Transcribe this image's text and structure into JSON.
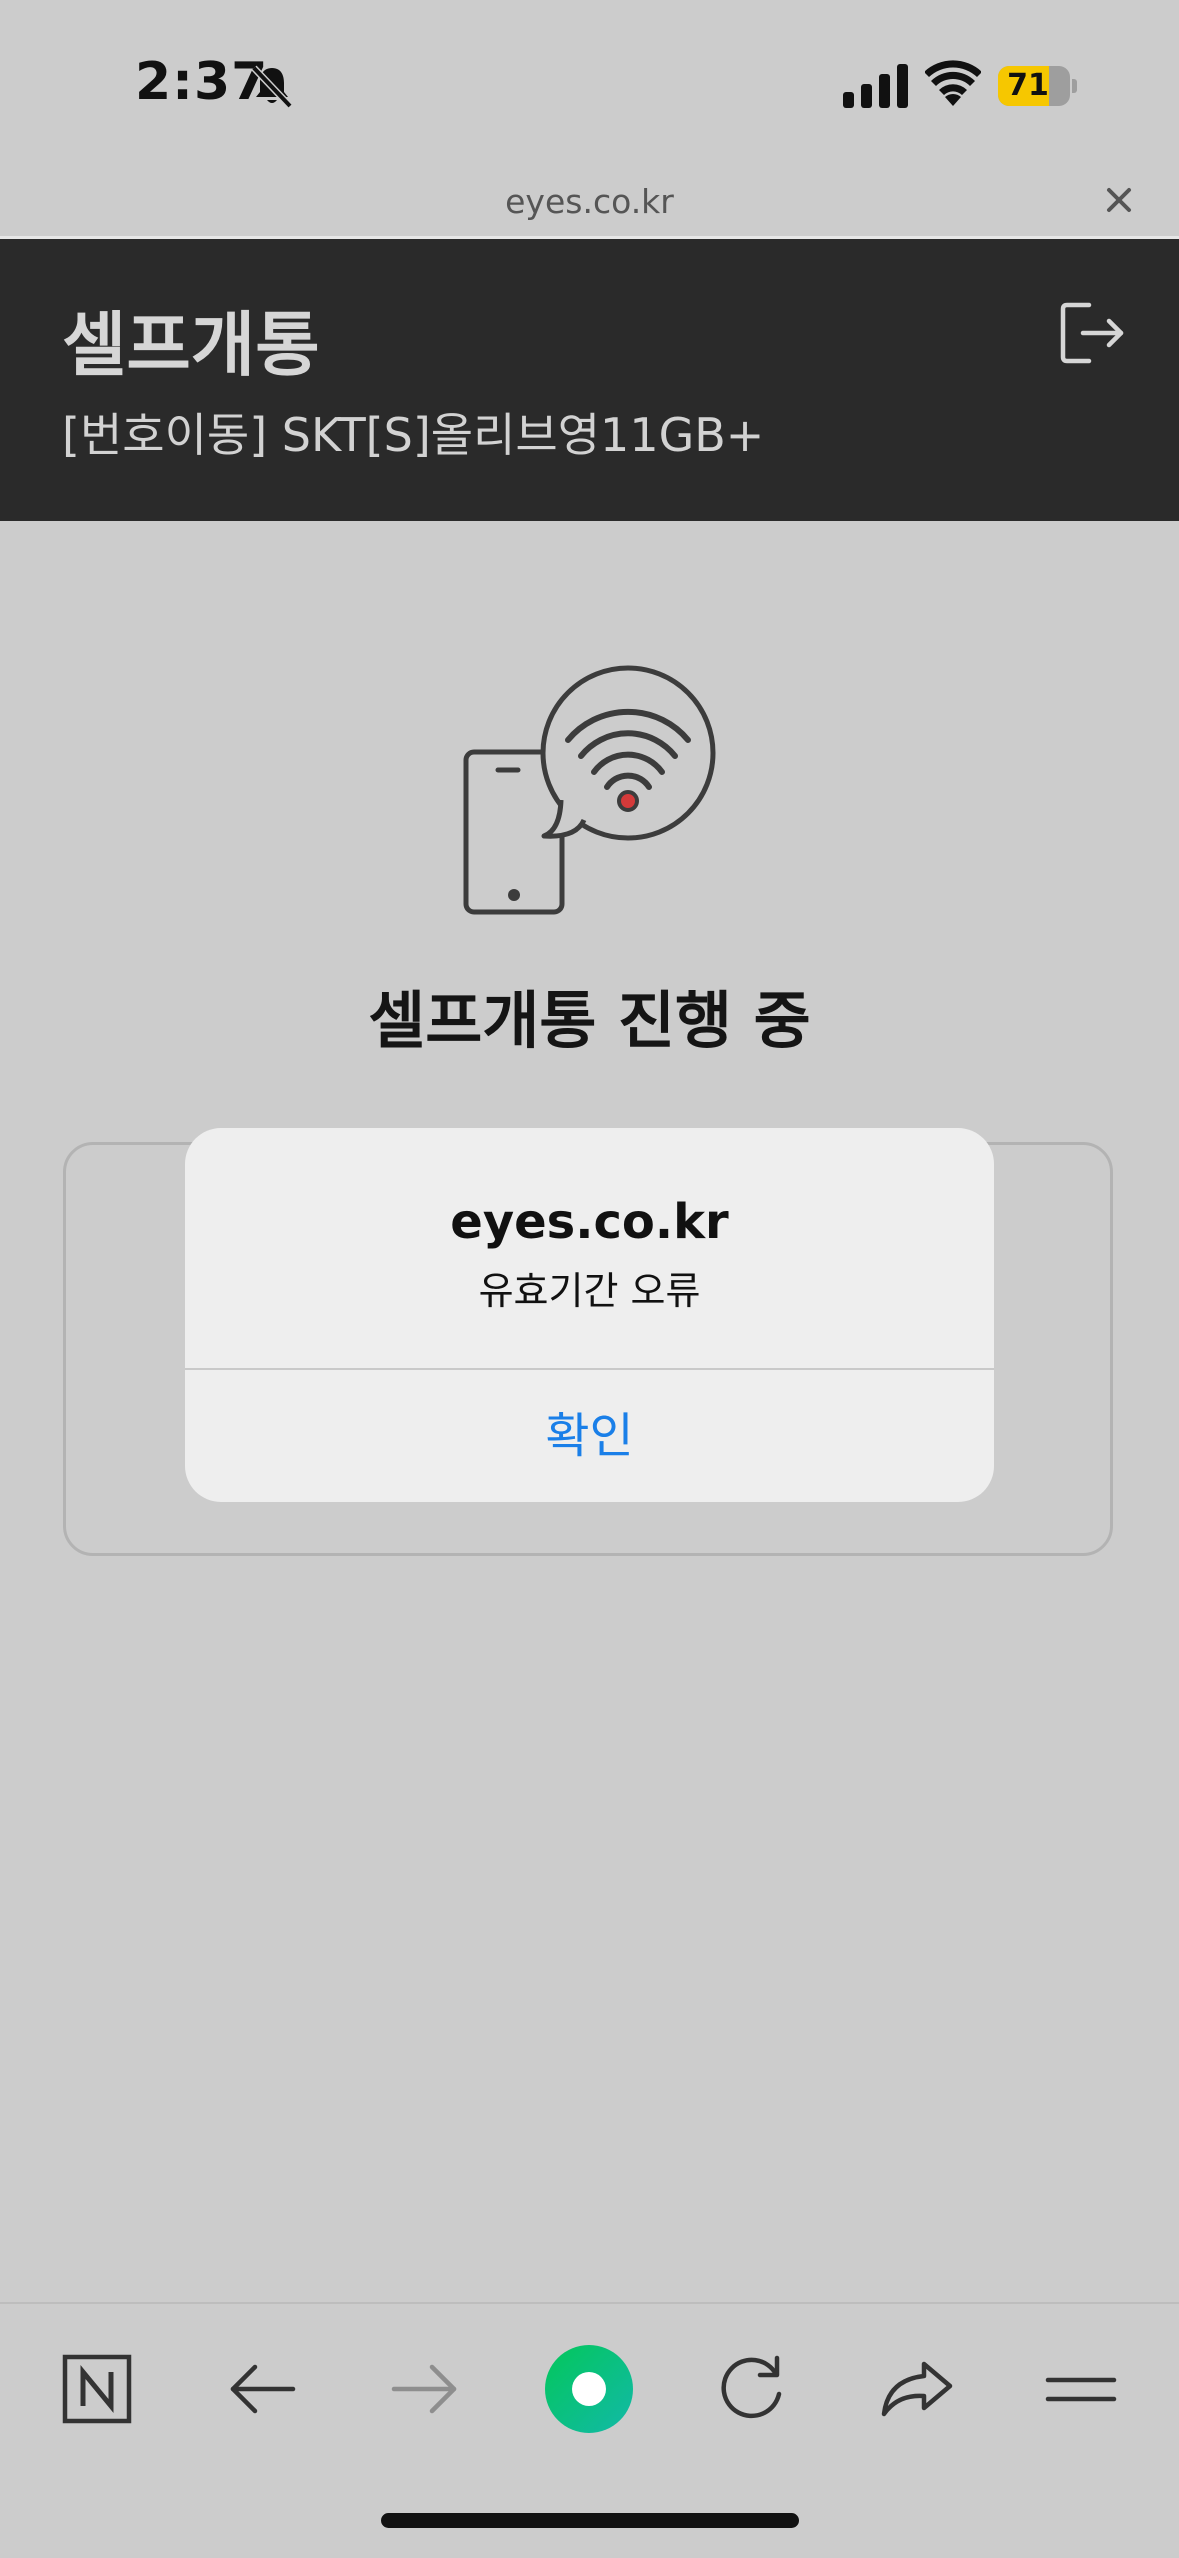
{
  "status_bar": {
    "time": "2:37",
    "battery_percent": "71",
    "battery_level": 0.71,
    "battery_color": "#f6c700",
    "icons": [
      "bell-slash-icon",
      "cellular-signal-icon",
      "wifi-icon",
      "battery-icon"
    ]
  },
  "browser": {
    "url": "eyes.co.kr",
    "close_icon": "close-icon"
  },
  "header": {
    "title": "셀프개통",
    "subtitle": "[번호이동] SKT[S]올리브영11GB+",
    "logout_icon": "logout-icon"
  },
  "main": {
    "illustration_icon": "phone-wifi-bubble-icon",
    "progress_title": "셀프개통 진행 중"
  },
  "alert": {
    "title": "eyes.co.kr",
    "message": "유효기간 오류",
    "confirm_label": "확인",
    "button_color": "#1a7fe8"
  },
  "toolbar": {
    "icons": [
      "naver-home-icon",
      "back-arrow-icon",
      "forward-arrow-icon",
      "naver-green-dot-icon",
      "reload-icon",
      "share-icon",
      "menu-icon"
    ],
    "accent": "#03c75a"
  }
}
